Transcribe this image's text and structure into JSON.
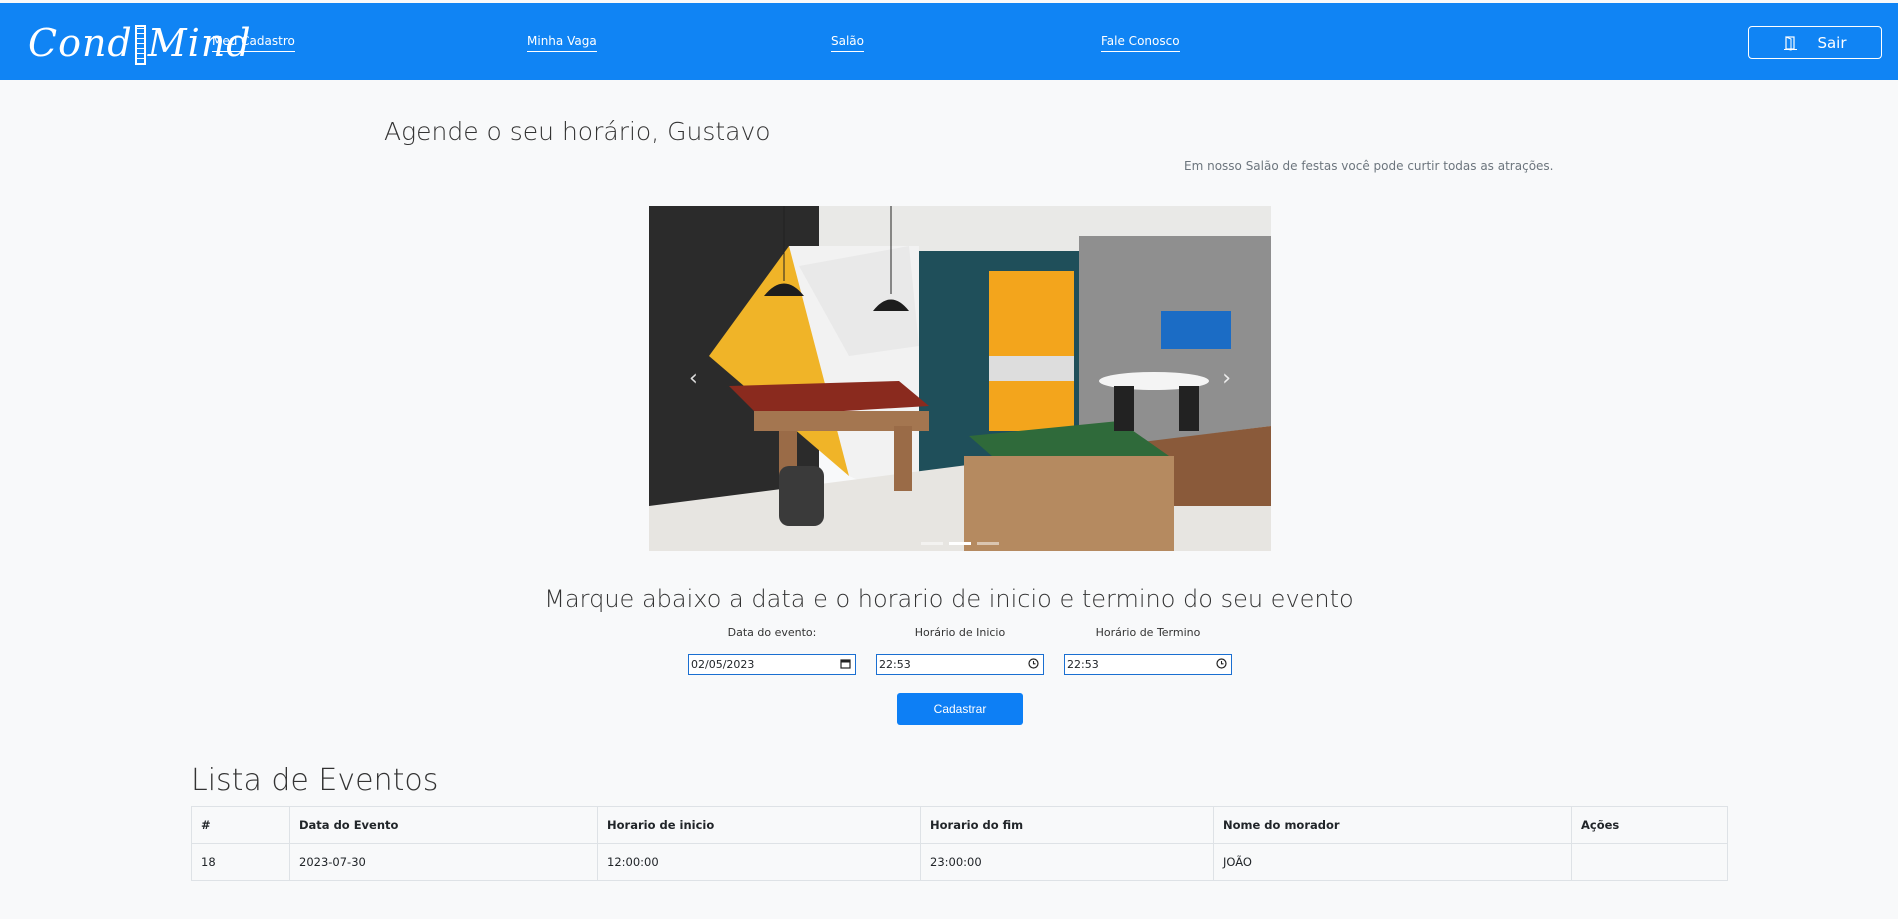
{
  "brand": {
    "logo_text_a": "Cond",
    "logo_text_b": "Mind"
  },
  "nav": {
    "links": [
      "Meu Cadastro",
      "Minha Vaga",
      "Salão",
      "Fale Conosco"
    ],
    "logout_label": "Sair",
    "logout_icon": "door-exit-icon"
  },
  "header": {
    "greeting": "Agende o seu horário, Gustavo",
    "tagline": "Em nosso Salão de festas você pode curtir todas as atrações."
  },
  "carousel": {
    "prev_icon": "‹",
    "next_icon": "›",
    "slide_count": 3,
    "active_slide": 2
  },
  "form": {
    "title": "Marque abaixo a data e o horario de inicio e termino do seu evento",
    "date_label": "Data do evento:",
    "start_label": "Horário de Inicio",
    "end_label": "Horário de Termino",
    "date_value": "02/05/2023",
    "start_value": "22:53",
    "end_value": "22:53",
    "submit_label": "Cadastrar"
  },
  "events": {
    "title": "Lista de Eventos",
    "columns": [
      "#",
      "Data do Evento",
      "Horario de inicio",
      "Horario do fim",
      "Nome do morador",
      "Ações"
    ],
    "rows": [
      [
        "18",
        "2023-07-30",
        "12:00:00",
        "23:00:00",
        "JOÃO",
        ""
      ]
    ]
  },
  "colors": {
    "navbar": "#1084f4",
    "primary_button": "#0d7ff5",
    "page_bg": "#f8f9fa"
  }
}
